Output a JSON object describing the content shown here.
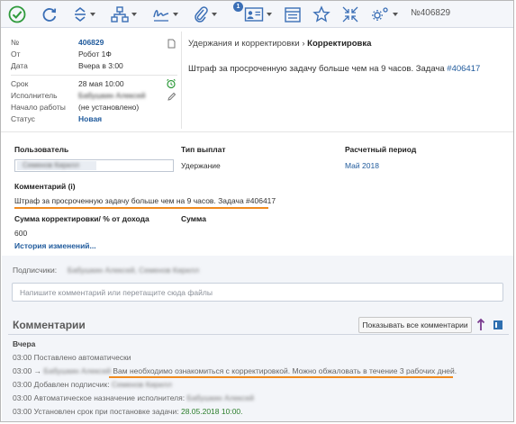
{
  "toolbar": {
    "badge_count": "1",
    "ticket_number": "№406829",
    "icons": [
      "check-circle-icon",
      "refresh-icon",
      "expand-collapse-icon",
      "hierarchy-icon",
      "signature-icon",
      "paperclip-icon",
      "contact-card-icon",
      "calendar-list-icon",
      "star-icon",
      "collapse-arrows-icon",
      "gear-icon"
    ]
  },
  "meta": {
    "number_label": "№",
    "number_value": "406829",
    "from_label": "От",
    "from_value": "Робот 1Ф",
    "date_label": "Дата",
    "date_value": "Вчера в 3:00",
    "deadline_label": "Срок",
    "deadline_value": "28 мая 10:00",
    "executor_label": "Исполнитель",
    "executor_value": "Бабушкин Алексей",
    "start_label": "Начало работы",
    "start_value": "(не установлено)",
    "status_label": "Статус",
    "status_value": "Новая"
  },
  "header": {
    "breadcrumb_parent": "Удержания и корректировки",
    "breadcrumb_sep": "›",
    "breadcrumb_current": "Корректировка",
    "description_text": "Штраф за просроченную задачу больше чем на 9 часов. Задача ",
    "description_link": "#406417"
  },
  "fields": {
    "user_label": "Пользователь",
    "user_value": "Семенов Кирилл",
    "paytype_label": "Тип выплат",
    "paytype_value": "Удержание",
    "period_label": "Расчетный период",
    "period_value": "Май 2018",
    "comment_label": "Комментарий (i)",
    "comment_value": "Штраф за просроченную задачу больше чем на 9 часов. Задача #406417",
    "sum_percent_label": "Сумма корректировки/ % от дохода",
    "sum_percent_value": "600",
    "sum_label": "Сумма",
    "history_link": "История изменений..."
  },
  "subscribers": {
    "label": "Подписчики:",
    "names": "Бабушкин Алексей, Семенов Кирилл"
  },
  "comment_input": {
    "placeholder": "Напишите комментарий или перетащите сюда файлы"
  },
  "comments": {
    "title": "Комментарии",
    "show_all_label": "Показывать все комментарии",
    "day_label": "Вчера",
    "events": [
      {
        "time": "03:00",
        "text": "Поставлено автоматически"
      },
      {
        "time": "03:00",
        "arrow": "→",
        "name": "Бабушкин Алексей",
        "text": "Вам необходимо ознакомиться с корректировкой. Можно обжаловать в течение 3 рабочих дней."
      },
      {
        "time": "03:00",
        "text": "Добавлен подписчик:",
        "name": "Семенов Кирилл"
      },
      {
        "time": "03:00",
        "text": "Автоматическое назначение исполнителя:",
        "name": "Бабушкин Алексей"
      },
      {
        "time": "03:00",
        "text": "Установлен срок при постановке задачи:",
        "date": "28.05.2018 10:00."
      }
    ]
  },
  "colors": {
    "accent": "#1f5a9c",
    "underline": "#f08a1e",
    "success": "#2a7d2a"
  }
}
